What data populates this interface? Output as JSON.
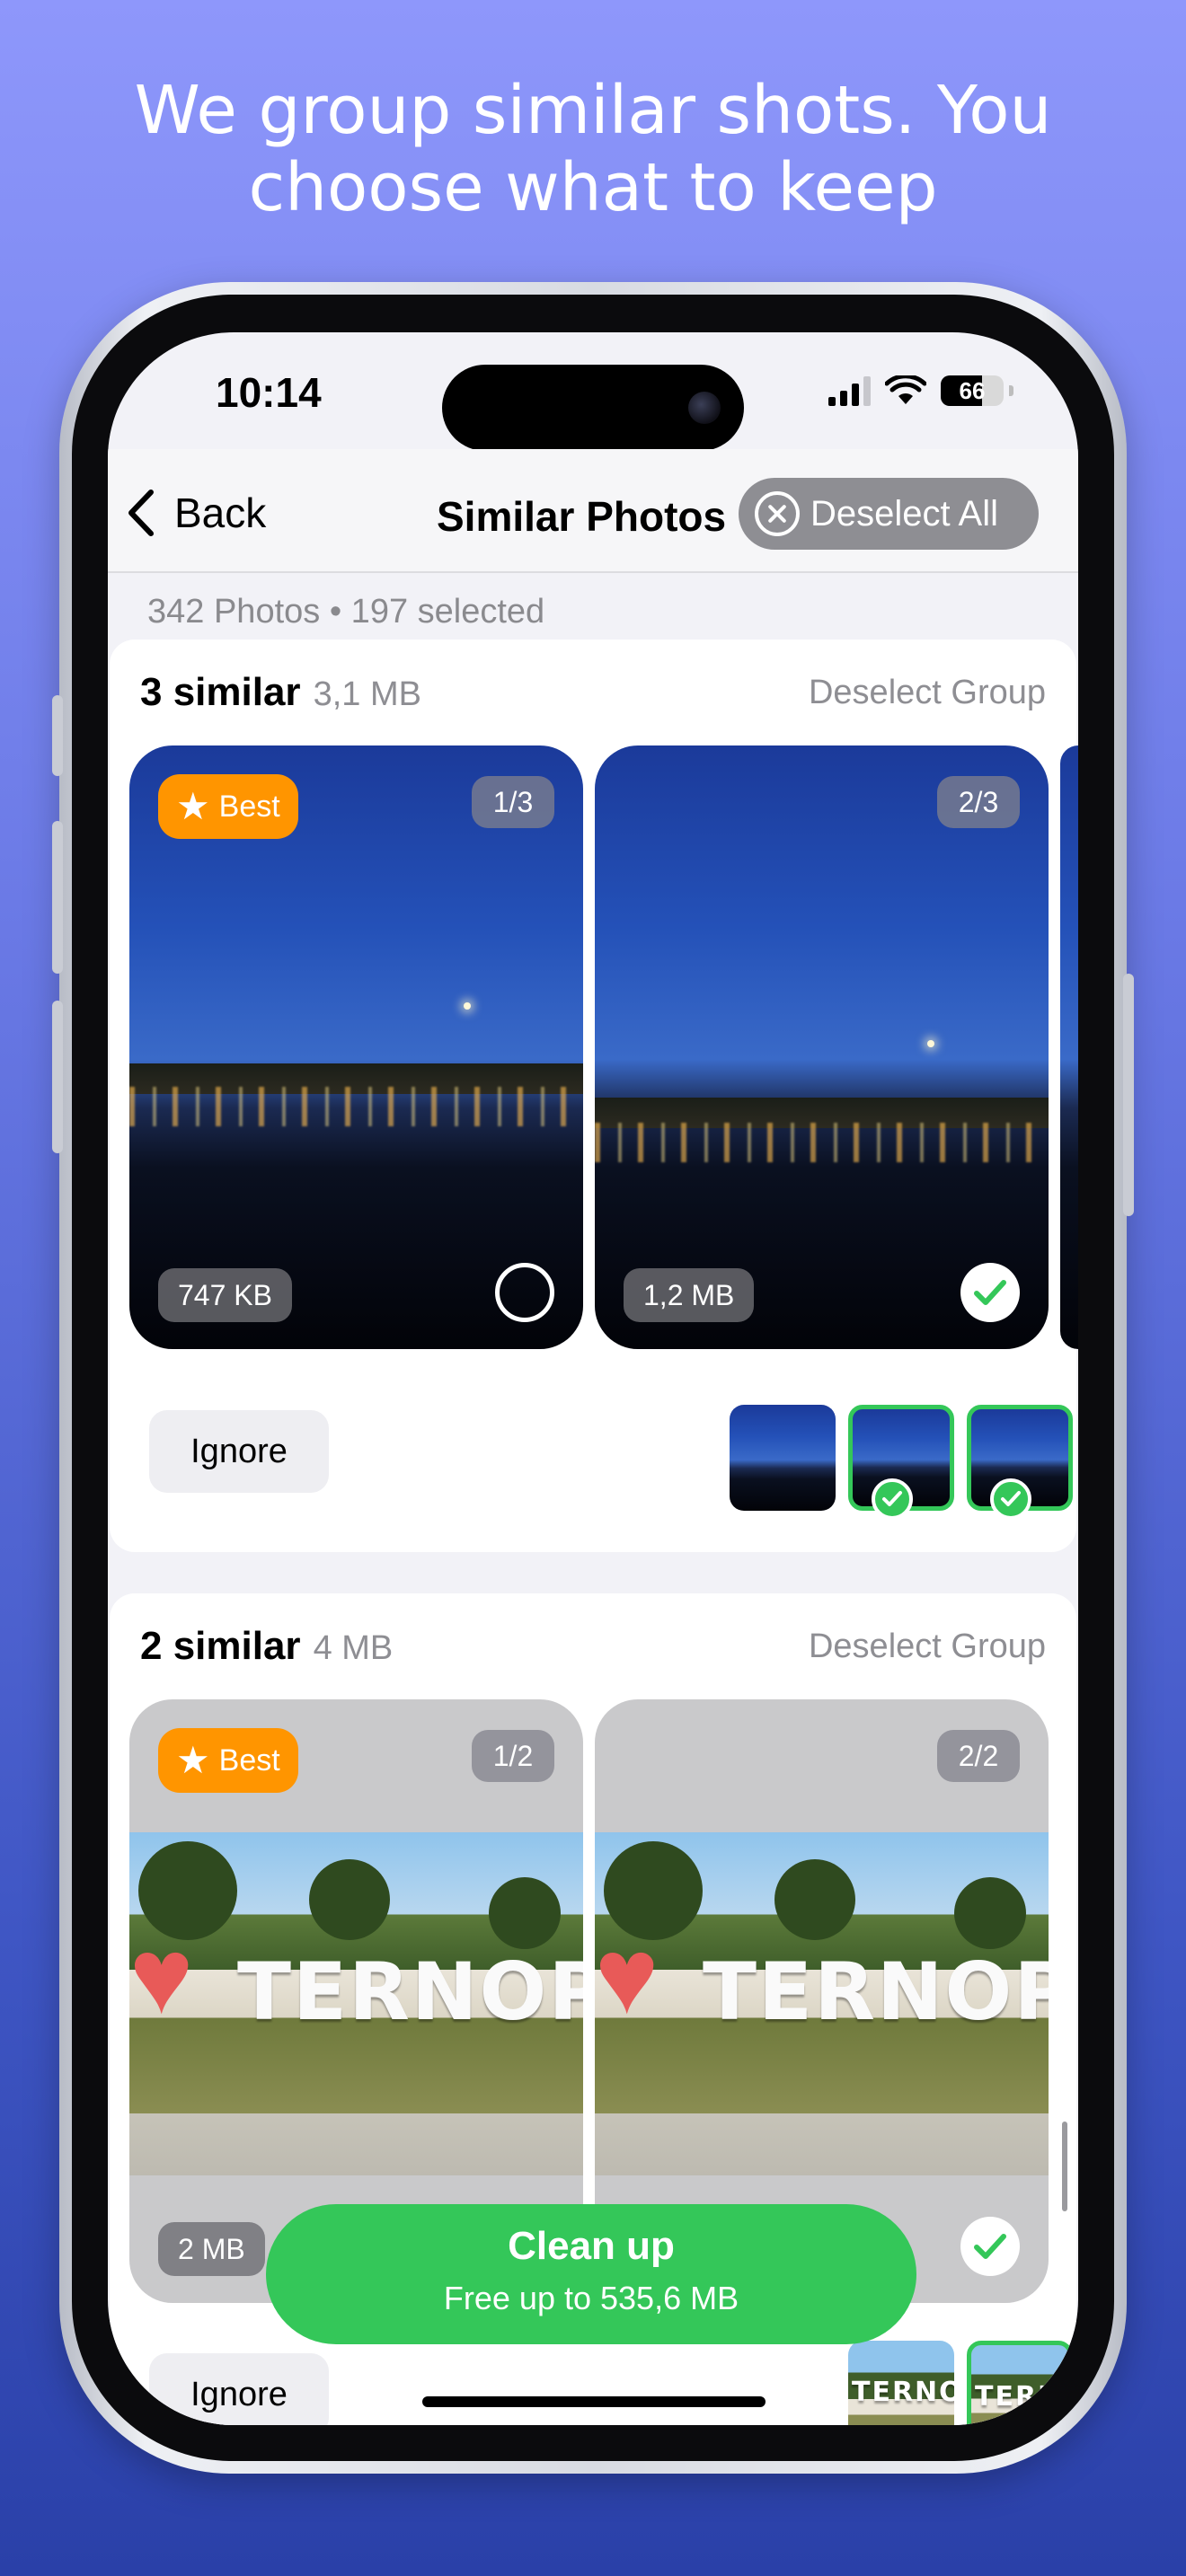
{
  "headline": {
    "line1": "We group similar shots. You",
    "line2": "choose what to keep"
  },
  "status_bar": {
    "time": "10:14",
    "battery": "66",
    "battery_level": 0.66
  },
  "nav": {
    "back_label": "Back",
    "title": "Similar Photos",
    "deselect_all_label": "Deselect All"
  },
  "summary": {
    "text": "342 Photos • 197 selected"
  },
  "groups": [
    {
      "title": "3 similar",
      "size": "3,1 MB",
      "deselect_label": "Deselect Group",
      "photos": [
        {
          "best_label": "Best",
          "index": "1/3",
          "size": "747 KB",
          "selected": false
        },
        {
          "index": "2/3",
          "size": "1,2 MB",
          "selected": true
        }
      ],
      "ignore_label": "Ignore",
      "thumbnails": [
        {
          "selected": false
        },
        {
          "selected": true
        },
        {
          "selected": true
        }
      ]
    },
    {
      "title": "2 similar",
      "size": "4 MB",
      "deselect_label": "Deselect Group",
      "photos": [
        {
          "best_label": "Best",
          "index": "1/2",
          "size": "2 MB",
          "selected": false,
          "sign_text": "TERNOPIL"
        },
        {
          "index": "2/2",
          "selected": true,
          "sign_text": "TERNOPIL"
        }
      ],
      "ignore_label": "Ignore",
      "thumbnails": [
        {
          "selected": false,
          "sign_text": "TERNOPIL"
        },
        {
          "selected": true,
          "sign_text": "TERNOPIL"
        }
      ]
    }
  ],
  "cleanup": {
    "title": "Clean up",
    "subtitle": "Free up to 535,6 MB"
  },
  "colors": {
    "accent_green": "#34c759",
    "best_orange": "#ff9500",
    "background_top": "#8e97fb",
    "background_bottom": "#2a40a8"
  },
  "icons": [
    "chevron-left-icon",
    "close-circle-icon",
    "star-icon",
    "checkmark-icon",
    "wifi-icon",
    "signal-icon",
    "battery-icon"
  ]
}
